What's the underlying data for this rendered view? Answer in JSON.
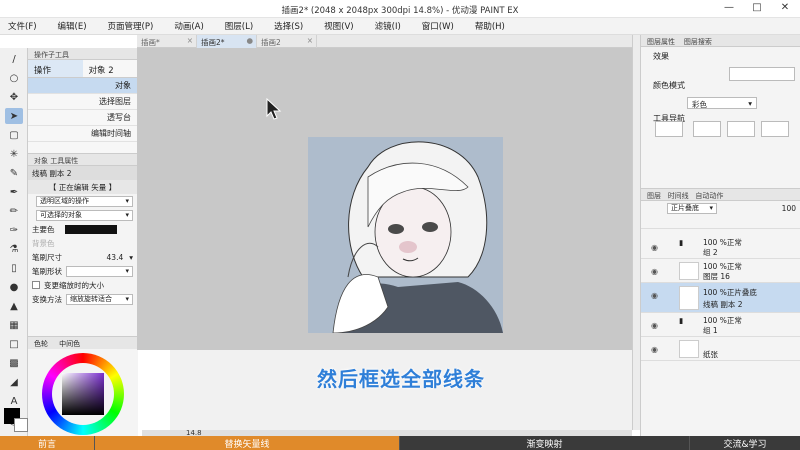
{
  "window": {
    "title": "插画2* (2048 x 2048px 300dpi 14.8%) - 优动漫 PAINT EX"
  },
  "menu": [
    "文件(F)",
    "编辑(E)",
    "页面管理(P)",
    "动画(A)",
    "图层(L)",
    "选择(S)",
    "视图(V)",
    "滤镜(I)",
    "窗口(W)",
    "帮助(H)"
  ],
  "tabs": [
    {
      "label": "插画*"
    },
    {
      "label": "插画2*"
    },
    {
      "label": "插画2"
    }
  ],
  "subtool": {
    "title": "操作子工具",
    "tabs": [
      "操作",
      "对象"
    ],
    "tab_count": "2",
    "items": [
      "对象",
      "选择图层",
      "透写台",
      "编辑时间轴"
    ]
  },
  "properties": {
    "title": "对象 工具属性",
    "layer_name": "线稿 副本 2",
    "editing_label": "【 正在编辑 矢量 】",
    "transparent_ops": "透明区域的操作",
    "selectable": "可选择的对象",
    "main_color": "主要色",
    "sub_color": "背景色",
    "brush_size_label": "笔刷尺寸",
    "brush_size_value": "43.4",
    "brush_shape_label": "笔刷形状",
    "scale_check": "变更缩放时的大小",
    "transform_label": "变换方法",
    "transform_value": "缩放旋转适合"
  },
  "color": {
    "tab1": "色轮",
    "tab2": "中间色"
  },
  "right_top": {
    "tabs": [
      "图层属性",
      "图层搜索"
    ],
    "effect_label": "效果",
    "color_mode_label": "颜色模式",
    "color_mode_value": "彩色",
    "tool_nav_label": "工具导航"
  },
  "layers": {
    "tabs": [
      "图层",
      "时间线",
      "自动动作"
    ],
    "blend": "正片叠底",
    "opacity": "100",
    "items": [
      {
        "l1": "100 %正常",
        "l2": "组 2"
      },
      {
        "l1": "100 %正常",
        "l2": "图层 16"
      },
      {
        "l1": "100 %正片叠底",
        "l2": "线稿 副本 2"
      },
      {
        "l1": "100 %正常",
        "l2": "组 1"
      },
      {
        "l1": "",
        "l2": "纸张"
      }
    ]
  },
  "canvas": {
    "zoom": "14.8"
  },
  "subtitle_text": "然后框选全部线条",
  "bottom_bar": [
    "前言",
    "替换矢量线",
    "渐变映射",
    "交流&学习"
  ],
  "colors": {
    "accent": "#2f7fd8",
    "bar_orange": "#e08a2a",
    "selection": "#c6daf0"
  }
}
